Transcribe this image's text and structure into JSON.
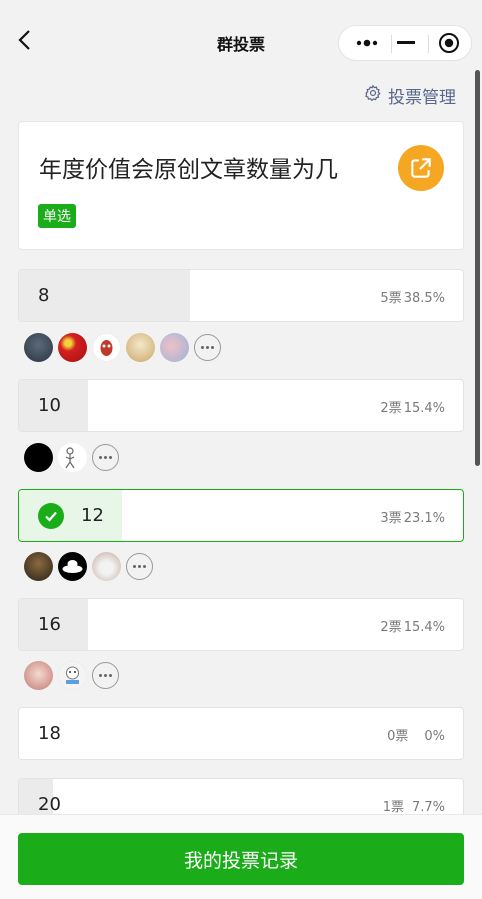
{
  "header": {
    "title": "群投票",
    "back_icon": "back-icon"
  },
  "manage": {
    "label": "投票管理",
    "icon": "gear-icon"
  },
  "question": {
    "title": "年度价值会原创文章数量为几",
    "type_badge": "单选",
    "share_icon": "share-icon"
  },
  "options": [
    {
      "label": "8",
      "votes": "5票",
      "percent": "38.5%",
      "selected": false
    },
    {
      "label": "10",
      "votes": "2票",
      "percent": "15.4%",
      "selected": false
    },
    {
      "label": "12",
      "votes": "3票",
      "percent": "23.1%",
      "selected": true
    },
    {
      "label": "16",
      "votes": "2票",
      "percent": "15.4%",
      "selected": false
    },
    {
      "label": "18",
      "votes": "0票",
      "percent": "0%",
      "selected": false
    },
    {
      "label": "20",
      "votes": "1票",
      "percent": "7.7%",
      "selected": false
    }
  ],
  "footer": {
    "button_label": "我的投票记录"
  },
  "colors": {
    "accent": "#1aad19",
    "share": "#f5a623",
    "link": "#58668a"
  }
}
